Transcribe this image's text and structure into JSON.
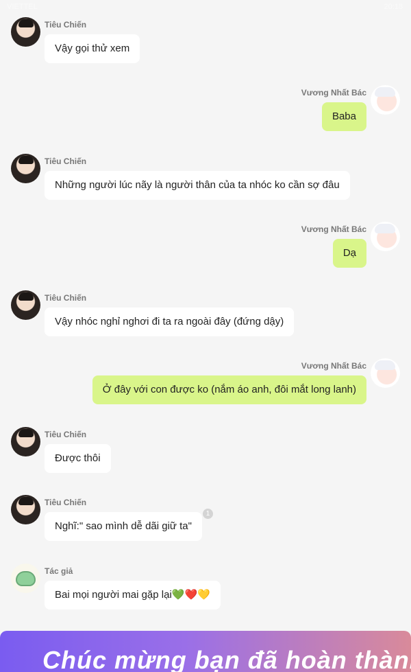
{
  "status_bar": {
    "carrier": "VIETTEL",
    "time": "20:18"
  },
  "messages": [
    {
      "side": "left",
      "avatar": "tieu-chien-avatar",
      "name": "Tiêu Chiến",
      "text": "Vậy gọi thử xem"
    },
    {
      "side": "right",
      "avatar": "vuong-nhat-bac-avatar",
      "name": "Vương Nhất Bác",
      "text": "Baba"
    },
    {
      "side": "left",
      "avatar": "tieu-chien-avatar",
      "name": "Tiêu Chiến",
      "text": "Những người lúc nãy là người thân của ta nhóc ko cần sợ đâu"
    },
    {
      "side": "right",
      "avatar": "vuong-nhat-bac-avatar",
      "name": "Vương Nhất Bác",
      "text": "Dạ"
    },
    {
      "side": "left",
      "avatar": "tieu-chien-avatar",
      "name": "Tiêu Chiến",
      "text": "Vậy nhóc nghỉ nghơi đi ta ra ngoài đây (đứng dậy)"
    },
    {
      "side": "right",
      "avatar": "vuong-nhat-bac-avatar",
      "name": "Vương Nhất Bác",
      "text": "Ở đây với con được ko (nắm áo anh, đôi mắt long lanh)"
    },
    {
      "side": "left",
      "avatar": "tieu-chien-avatar",
      "name": "Tiêu Chiến",
      "text": "Được thôi"
    },
    {
      "side": "left",
      "avatar": "tieu-chien-avatar",
      "name": "Tiêu Chiến",
      "text": "Nghĩ:\" sao mình dễ dãi giữ ta\"",
      "comment_count": "1"
    },
    {
      "side": "left",
      "avatar": "author-avatar",
      "name": "Tác giả",
      "text": "Bai mọi người mai gặp lại💚❤️💛"
    }
  ],
  "footer_banner": {
    "text": "Chúc mừng bạn đã hoàn thành chương"
  }
}
